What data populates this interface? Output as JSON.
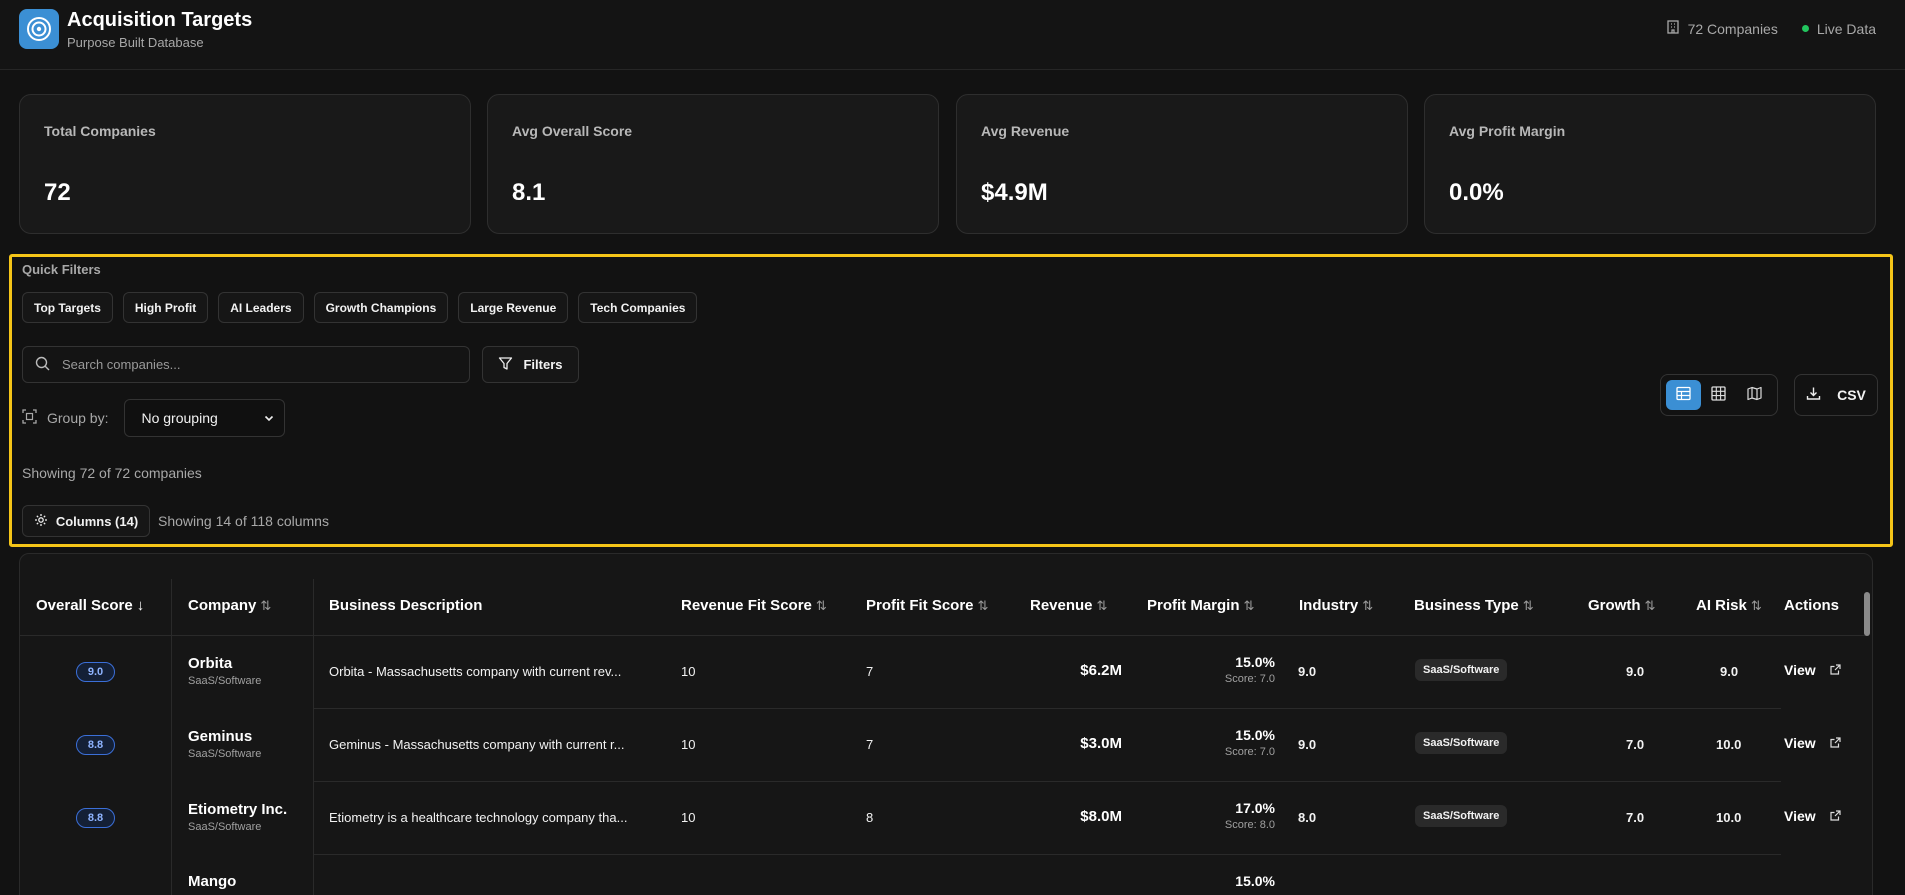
{
  "header": {
    "title": "Acquisition Targets",
    "subtitle": "Purpose Built Database",
    "companies_count": "72 Companies",
    "live_label": "Live Data"
  },
  "stats": [
    {
      "label": "Total Companies",
      "value": "72"
    },
    {
      "label": "Avg Overall Score",
      "value": "8.1"
    },
    {
      "label": "Avg Revenue",
      "value": "$4.9M"
    },
    {
      "label": "Avg Profit Margin",
      "value": "0.0%"
    }
  ],
  "filters": {
    "quick_filters_title": "Quick Filters",
    "quick_filters": [
      "Top Targets",
      "High Profit",
      "AI Leaders",
      "Growth Champions",
      "Large Revenue",
      "Tech Companies"
    ],
    "search_placeholder": "Search companies...",
    "filters_label": "Filters",
    "group_by_label": "Group by:",
    "group_by_value": "No grouping",
    "showing_text": "Showing 72 of 72 companies",
    "columns_label": "Columns (14)",
    "columns_info": "Showing 14 of 118 columns",
    "csv_label": "CSV",
    "active_view": "table"
  },
  "table": {
    "headers": {
      "overall_score": "Overall Score",
      "company": "Company",
      "business_description": "Business Description",
      "revenue_fit_score": "Revenue Fit Score",
      "profit_fit_score": "Profit Fit Score",
      "revenue": "Revenue",
      "profit_margin": "Profit Margin",
      "industry": "Industry",
      "business_type": "Business Type",
      "growth": "Growth",
      "ai_risk": "AI Risk",
      "actions": "Actions"
    },
    "sort_desc_icon": "↓",
    "sort_icon": "⇅",
    "rows": [
      {
        "score": "9.0",
        "name": "Orbita",
        "type": "SaaS/Software",
        "description": "Orbita - Massachusetts company with current rev...",
        "revenue_fit": "10",
        "profit_fit": "7",
        "revenue": "$6.2M",
        "margin": "15.0%",
        "margin_score": "Score: 7.0",
        "industry": "9.0",
        "business_type": "SaaS/Software",
        "growth": "9.0",
        "ai_risk": "9.0",
        "action": "View"
      },
      {
        "score": "8.8",
        "name": "Geminus",
        "type": "SaaS/Software",
        "description": "Geminus - Massachusetts company with current r...",
        "revenue_fit": "10",
        "profit_fit": "7",
        "revenue": "$3.0M",
        "margin": "15.0%",
        "margin_score": "Score: 7.0",
        "industry": "9.0",
        "business_type": "SaaS/Software",
        "growth": "7.0",
        "ai_risk": "10.0",
        "action": "View"
      },
      {
        "score": "8.8",
        "name": "Etiometry Inc.",
        "type": "SaaS/Software",
        "description": "Etiometry is a healthcare technology company tha...",
        "revenue_fit": "10",
        "profit_fit": "8",
        "revenue": "$8.0M",
        "margin": "17.0%",
        "margin_score": "Score: 8.0",
        "industry": "8.0",
        "business_type": "SaaS/Software",
        "growth": "7.0",
        "ai_risk": "10.0",
        "action": "View"
      },
      {
        "score": "",
        "name": "Mango",
        "type": "",
        "description": "",
        "revenue_fit": "",
        "profit_fit": "",
        "revenue": "",
        "margin": "15.0%",
        "margin_score": "",
        "industry": "",
        "business_type": "",
        "growth": "",
        "ai_risk": "",
        "action": ""
      }
    ]
  },
  "colors": {
    "accent": "#3b8fd4",
    "highlight_border": "#f5c518",
    "live": "#22c55e"
  }
}
